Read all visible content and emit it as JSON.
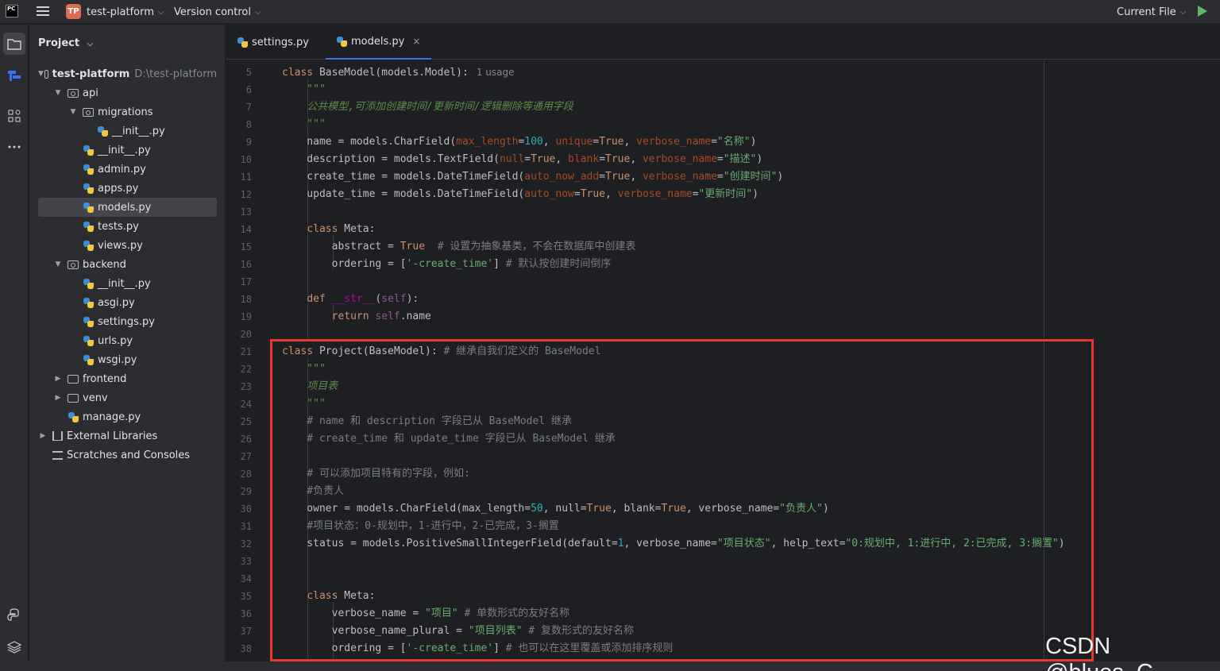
{
  "titlebar": {
    "app_logo": "PC",
    "project_badge": "TP",
    "project_name": "test-platform",
    "vcs_label": "Version control",
    "run_config": "Current File",
    "chevron": "⌵"
  },
  "toolstrip": {
    "icons": [
      "folder-icon",
      "commit-icon",
      "structure-icon",
      "more-icon",
      "python-console-icon",
      "layers-icon"
    ]
  },
  "project_panel": {
    "header": "Project",
    "root_name": "test-platform",
    "root_path": "D:\\test-platform",
    "items": [
      {
        "label": "api"
      },
      {
        "label": "migrations"
      },
      {
        "label": "__init__.py"
      },
      {
        "label": "__init__.py"
      },
      {
        "label": "admin.py"
      },
      {
        "label": "apps.py"
      },
      {
        "label": "models.py"
      },
      {
        "label": "tests.py"
      },
      {
        "label": "views.py"
      },
      {
        "label": "backend"
      },
      {
        "label": "__init__.py"
      },
      {
        "label": "asgi.py"
      },
      {
        "label": "settings.py"
      },
      {
        "label": "urls.py"
      },
      {
        "label": "wsgi.py"
      },
      {
        "label": "frontend"
      },
      {
        "label": "venv"
      },
      {
        "label": "manage.py"
      },
      {
        "label": "External Libraries"
      },
      {
        "label": "Scratches and Consoles"
      }
    ]
  },
  "tabs": [
    {
      "label": "settings.py"
    },
    {
      "label": "models.py",
      "close": "×"
    }
  ],
  "editor": {
    "usage_hint": "1 usage",
    "line_numbers": [
      "5",
      "6",
      "7",
      "8",
      "9",
      "10",
      "11",
      "12",
      "13",
      "14",
      "15",
      "16",
      "17",
      "18",
      "19",
      "20",
      "21",
      "22",
      "23",
      "24",
      "25",
      "26",
      "27",
      "28",
      "29",
      "30",
      "31",
      "32",
      "33",
      "34",
      "35",
      "36",
      "37",
      "38"
    ]
  },
  "watermark": "CSDN @blues_C",
  "colors": {
    "highlight_box": "#e8372c",
    "keyword": "#cf8e6d",
    "string": "#6aab73",
    "number": "#2aacb8"
  }
}
